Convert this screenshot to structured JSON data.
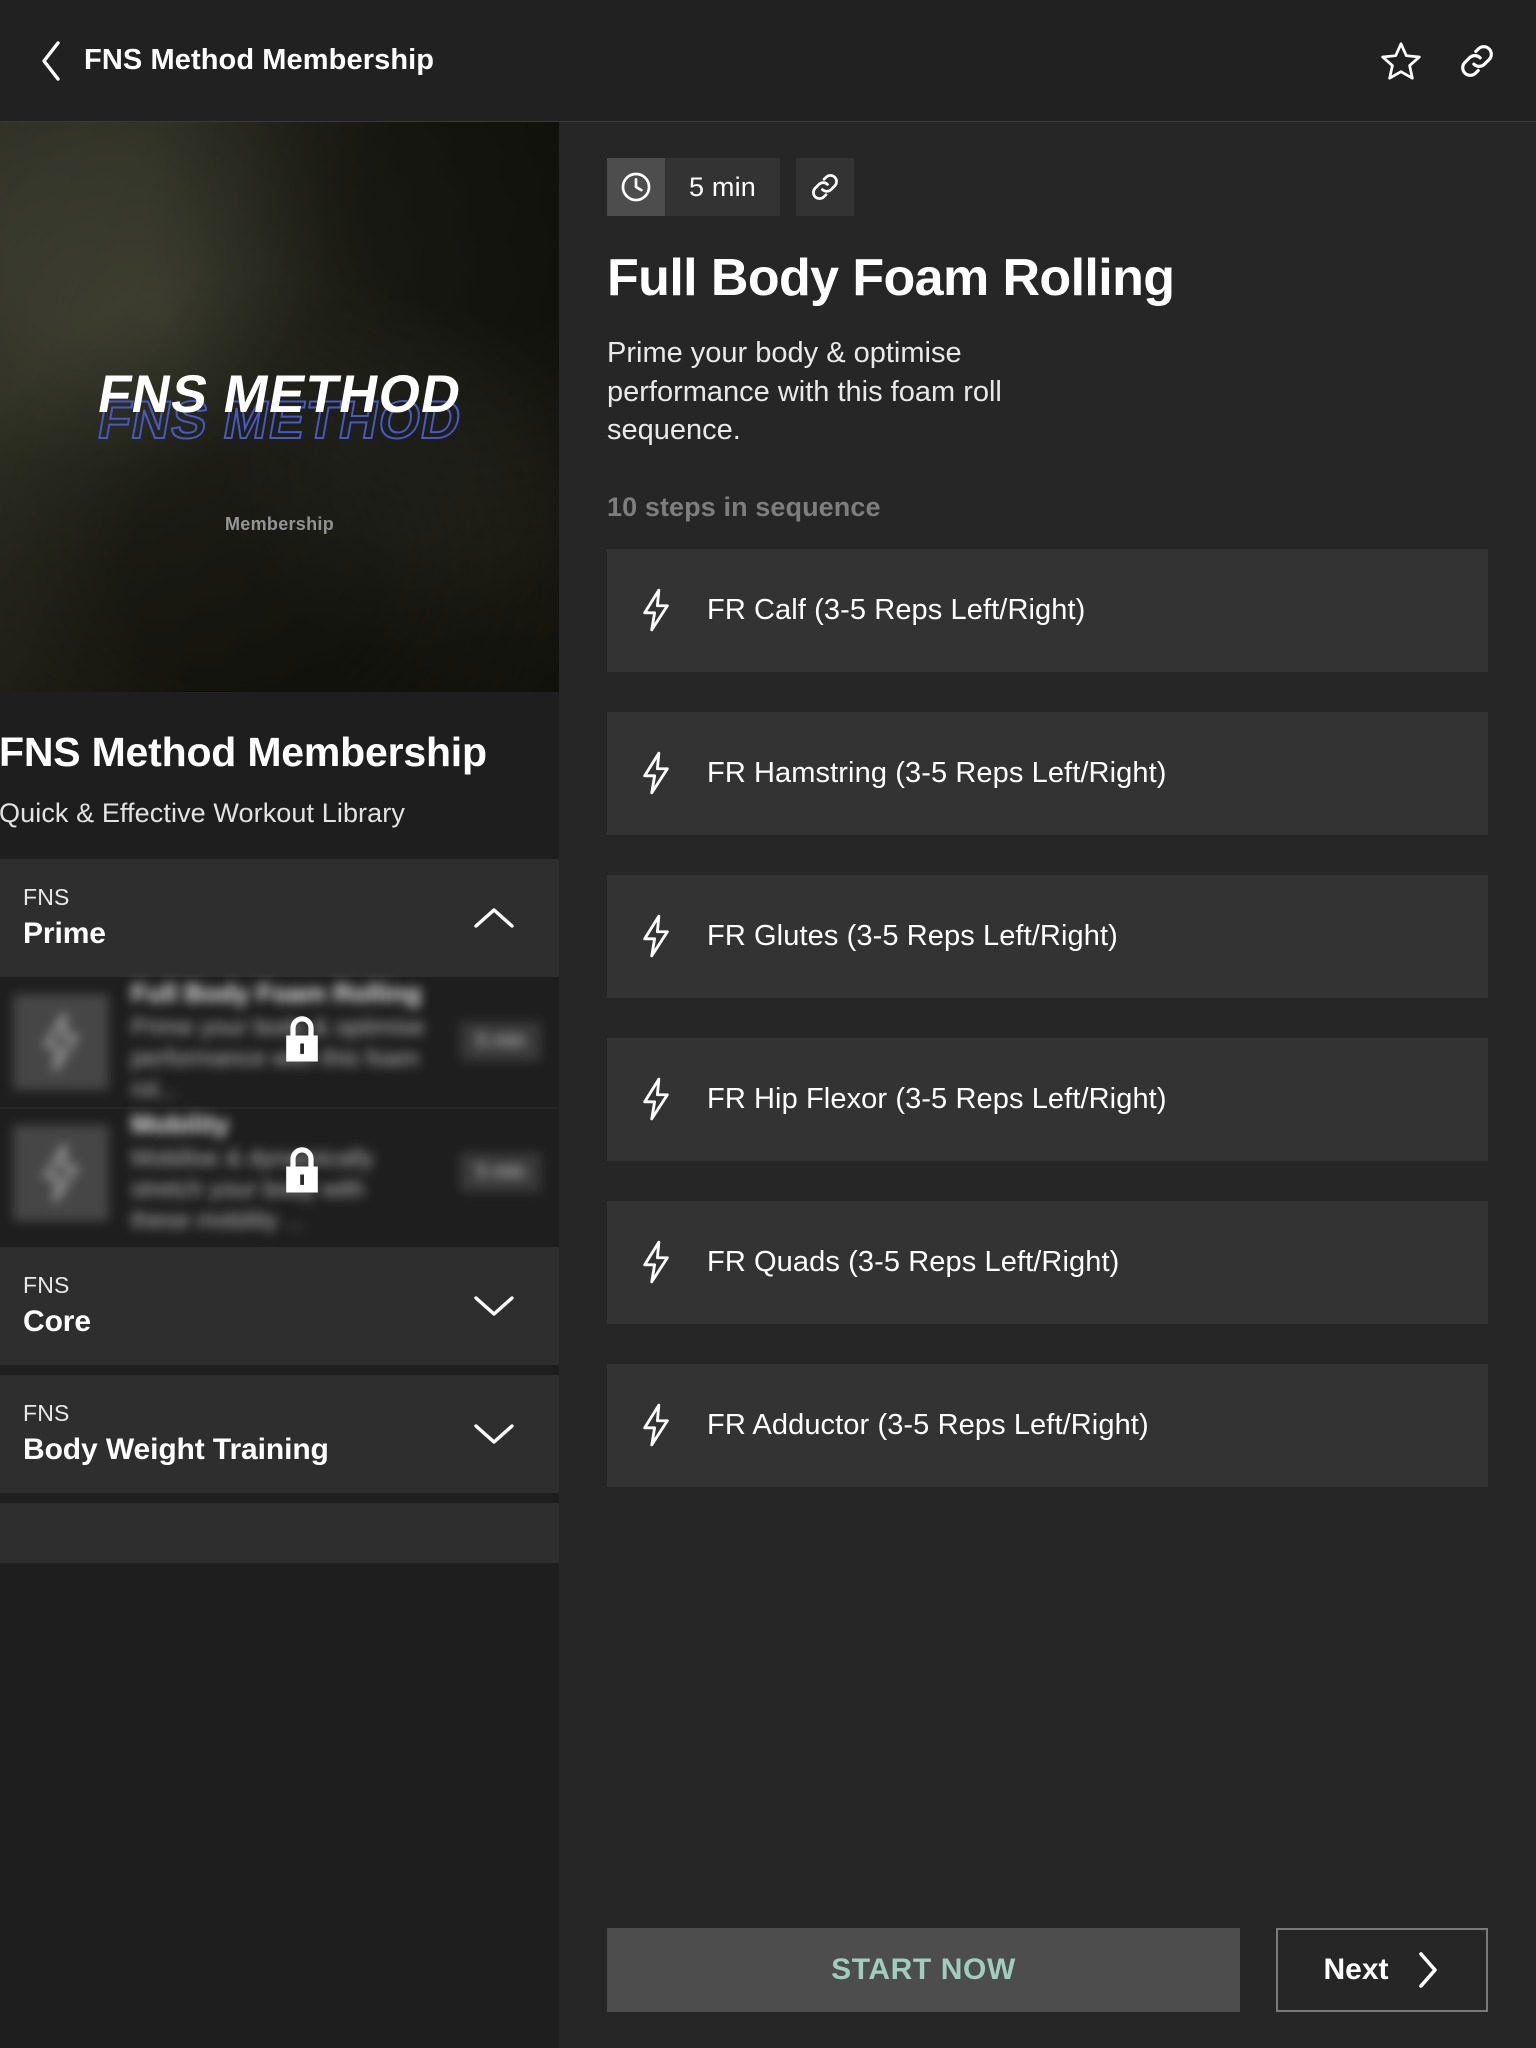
{
  "topbar": {
    "title": "FNS Method Membership",
    "back_icon": "chevron-left-icon",
    "favorite_icon": "star-outline-icon",
    "share_icon": "link-icon"
  },
  "left": {
    "cover": {
      "logo_main": "FNS METHOD",
      "logo_ghost": "FNS METHOD",
      "logo_sub": "Membership",
      "ghost_color": "#4659c7"
    },
    "title": "FNS Method Membership",
    "subtitle": "Quick & Effective Workout Library",
    "sections": [
      {
        "eyebrow": "FNS",
        "name": "Prime",
        "expanded": true,
        "chevron": "chevron-up-icon",
        "items": [
          {
            "title": "Full Body Foam Rolling",
            "description": "Prime your body & optimise performance with this foam rol...",
            "duration": "5 min",
            "locked": true,
            "lock_icon": "lock-icon",
            "thumb_icon": "bolt-icon"
          },
          {
            "title": "Mobility",
            "description": "Mobilise & dynamically stretch your body with these mobility ...",
            "duration": "5 min",
            "locked": true,
            "lock_icon": "lock-icon",
            "thumb_icon": "bolt-icon"
          }
        ]
      },
      {
        "eyebrow": "FNS",
        "name": "Core",
        "expanded": false,
        "chevron": "chevron-down-icon",
        "items": []
      },
      {
        "eyebrow": "FNS",
        "name": "Body Weight Training",
        "expanded": false,
        "chevron": "chevron-down-icon",
        "items": []
      }
    ]
  },
  "right": {
    "duration": "5 min",
    "clock_icon": "clock-icon",
    "link_icon": "link-icon",
    "title": "Full Body Foam Rolling",
    "description": "Prime your body & optimise performance with this foam roll sequence.",
    "steps_count_label": "10 steps in sequence",
    "steps": [
      {
        "name": "FR Calf (3-5 Reps Left/Right)",
        "icon": "bolt-icon"
      },
      {
        "name": "FR Hamstring (3-5 Reps Left/Right)",
        "icon": "bolt-icon"
      },
      {
        "name": "FR Glutes (3-5 Reps Left/Right)",
        "icon": "bolt-icon"
      },
      {
        "name": "FR Hip Flexor (3-5 Reps Left/Right)",
        "icon": "bolt-icon"
      },
      {
        "name": "FR Quads (3-5 Reps Left/Right)",
        "icon": "bolt-icon"
      },
      {
        "name": "FR Adductor (3-5 Reps Left/Right)",
        "icon": "bolt-icon"
      }
    ],
    "start_label": "START NOW",
    "next_label": "Next",
    "next_icon": "chevron-right-icon",
    "start_text_color": "#9fcdbe"
  }
}
